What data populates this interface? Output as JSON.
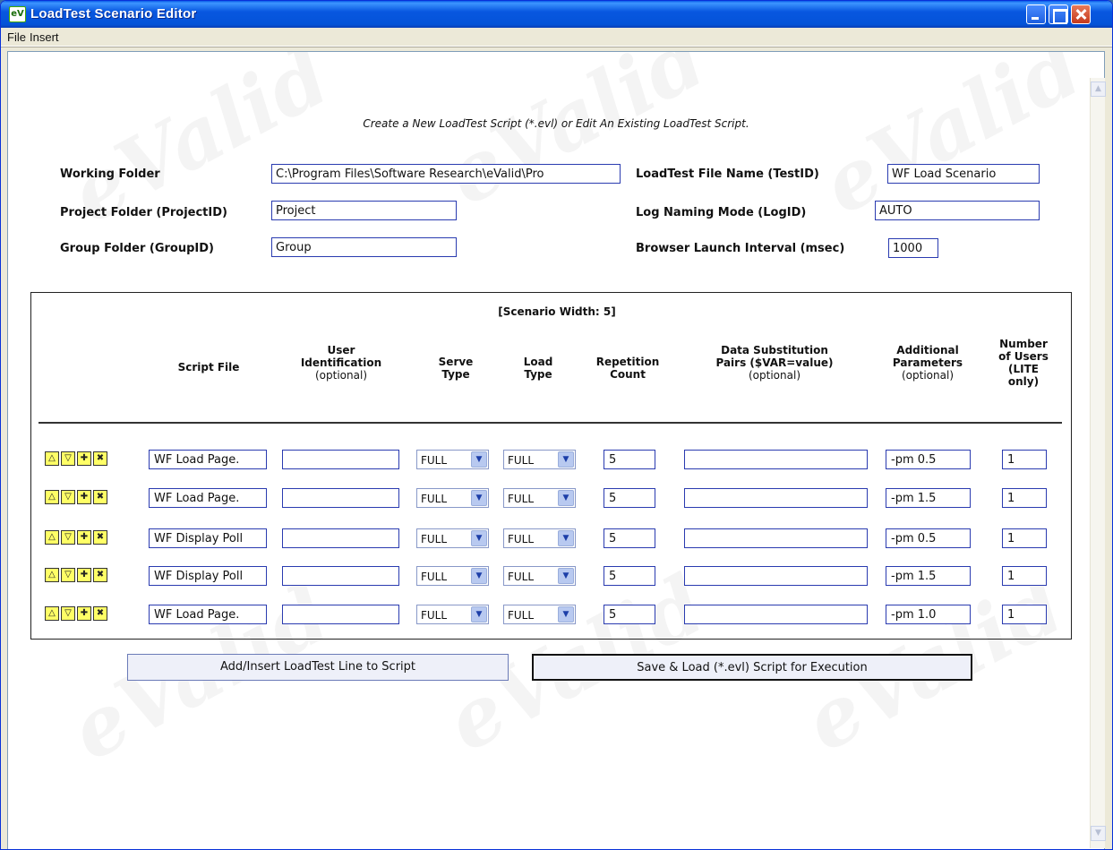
{
  "window": {
    "title": "LoadTest Scenario Editor",
    "icon_text": "eV"
  },
  "menu": {
    "file": "File",
    "insert": "Insert"
  },
  "subtitle": "Create a New LoadTest Script (*.evl) or Edit An Existing LoadTest Script.",
  "watermark_text": "eValid",
  "form": {
    "working_folder": {
      "label": "Working Folder",
      "value": "C:\\Program Files\\Software Research\\eValid\\Pro"
    },
    "project_folder": {
      "label": "Project Folder (ProjectID)",
      "value": "Project"
    },
    "group_folder": {
      "label": "Group Folder (GroupID)",
      "value": "Group"
    },
    "loadtest_file": {
      "label": "LoadTest File Name (TestID)",
      "value": "WF Load Scenario"
    },
    "log_naming": {
      "label": "Log Naming Mode (LogID)",
      "value": "AUTO"
    },
    "launch_interval": {
      "label": "Browser Launch Interval (msec)",
      "value": "1000"
    }
  },
  "scenario": {
    "width_label": "[Scenario Width: 5]",
    "columns": {
      "script_file": "Script File",
      "user_id_1": "User",
      "user_id_2": "Identification",
      "user_id_opt": "(optional)",
      "serve_1": "Serve",
      "serve_2": "Type",
      "load_1": "Load",
      "load_2": "Type",
      "rep_1": "Repetition",
      "rep_2": "Count",
      "data_1": "Data Substitution",
      "data_2": "Pairs ($VAR=value)",
      "data_opt": "(optional)",
      "add_1": "Additional",
      "add_2": "Parameters",
      "add_opt": "(optional)",
      "users_1": "Number",
      "users_2": "of Users",
      "users_3": "(LITE",
      "users_4": "only)"
    },
    "row_icons": [
      "up-arrow-icon",
      "down-arrow-icon",
      "add-icon",
      "delete-icon"
    ],
    "rows": [
      {
        "script": "WF Load Page.",
        "user": "",
        "serve": "FULL",
        "load": "FULL",
        "reps": "5",
        "data": "",
        "params": "-pm 0.5",
        "users": "1"
      },
      {
        "script": "WF Load Page.",
        "user": "",
        "serve": "FULL",
        "load": "FULL",
        "reps": "5",
        "data": "",
        "params": "-pm 1.5",
        "users": "1"
      },
      {
        "script": "WF Display Poll",
        "user": "",
        "serve": "FULL",
        "load": "FULL",
        "reps": "5",
        "data": "",
        "params": "-pm 0.5",
        "users": "1"
      },
      {
        "script": "WF Display Poll",
        "user": "",
        "serve": "FULL",
        "load": "FULL",
        "reps": "5",
        "data": "",
        "params": "-pm 1.5",
        "users": "1"
      },
      {
        "script": "WF Load Page.",
        "user": "",
        "serve": "FULL",
        "load": "FULL",
        "reps": "5",
        "data": "",
        "params": "-pm 1.0",
        "users": "1"
      }
    ]
  },
  "buttons": {
    "add_line": "Add/Insert LoadTest Line to Script",
    "save_load": "Save & Load (*.evl) Script for Execution"
  }
}
